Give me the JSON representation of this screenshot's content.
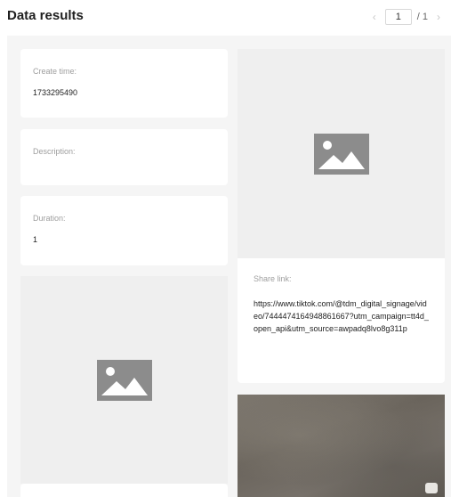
{
  "header": {
    "title": "Data results",
    "pagination": {
      "prev_icon": "chevron-left-icon",
      "next_icon": "chevron-right-icon",
      "current_page": "1",
      "total_label": "/ 1"
    }
  },
  "cards": {
    "create_time": {
      "label": "Create time:",
      "value": "1733295490"
    },
    "description": {
      "label": "Description:",
      "value": ""
    },
    "duration": {
      "label": "Duration:",
      "value": "1"
    },
    "share_link": {
      "label": "Share link:",
      "value": "https://www.tiktok.com/@tdm_digital_signage/video/7444474164948861667?utm_campaign=tt4d_open_api&utm_source=awpadq8lvo8g311p"
    }
  },
  "icons": {
    "placeholder": "image-placeholder-icon"
  },
  "colors": {
    "background": "#f5f5f5",
    "card": "#ffffff",
    "placeholder_icon": "#8c8c8c"
  }
}
